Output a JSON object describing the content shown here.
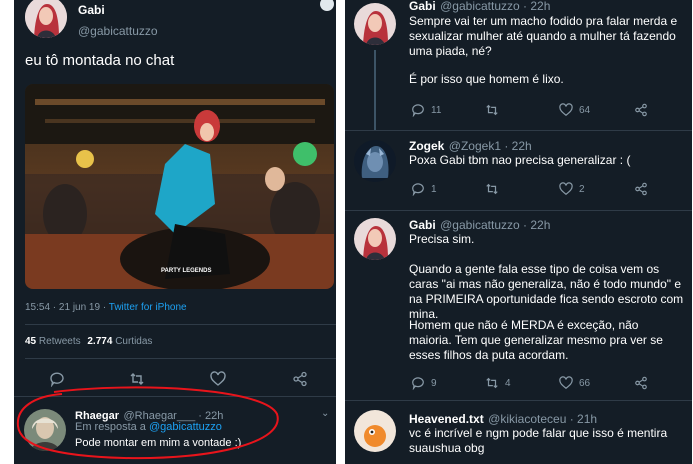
{
  "left": {
    "author_name": "Gabi",
    "author_handle": "@gabicattuzzo",
    "tweet_text": "eu tô montada no chat",
    "meta_time": "15:54 · 21 jun 19 · ",
    "meta_source": "Twitter for iPhone",
    "retweets_count": "45",
    "retweets_label": "Retweets",
    "likes_count": "2.774",
    "likes_label": "Curtidas",
    "reply": {
      "name": "Rhaegar",
      "handle": "@Rhaegar___ · 22h",
      "replying_prefix": "Em resposta a ",
      "replying_to": "@gabicattuzzo",
      "text": "Pode montar em mim a vontade :)"
    }
  },
  "right": {
    "tweets": [
      {
        "name": "Gabi",
        "handle": "@gabicattuzzo · 22h",
        "para1": "Sempre vai ter um macho fodido pra falar merda e sexualizar mulher até quando a mulher tá fazendo uma piada, né?",
        "para2": "É por isso que homem é lixo.",
        "replies": "11",
        "retweets": "",
        "likes": "64"
      },
      {
        "name": "Zogek",
        "handle": "@Zogek1 · 22h",
        "para1": "Poxa Gabi tbm nao precisa generalizar : (",
        "replies": "1",
        "retweets": "",
        "likes": "2"
      },
      {
        "name": "Gabi",
        "handle": "@gabicattuzzo · 22h",
        "para1": "Precisa sim.",
        "para2": "Quando a gente fala esse tipo de coisa vem os caras \"ai mas não generaliza, não é todo mundo\" e na PRIMEIRA oportunidade fica sendo escroto com mina.",
        "para3": "Homem que não é MERDA é exceção, não maioria. Tem que generalizar mesmo pra ver se esses filhos da puta acordam.",
        "replies": "9",
        "retweets": "4",
        "likes": "66"
      },
      {
        "name": "Heavened.txt",
        "handle": "@kikiacoteceu · 21h",
        "para1": "vc é incrível e ngm pode falar que isso é mentira suaushua obg"
      }
    ]
  },
  "photo_caption": "PARTY LEGENDS",
  "colors": {
    "bg": "#141d26",
    "accent": "#1da1f2",
    "muted": "#8899a6",
    "annotation": "#e8141b"
  }
}
